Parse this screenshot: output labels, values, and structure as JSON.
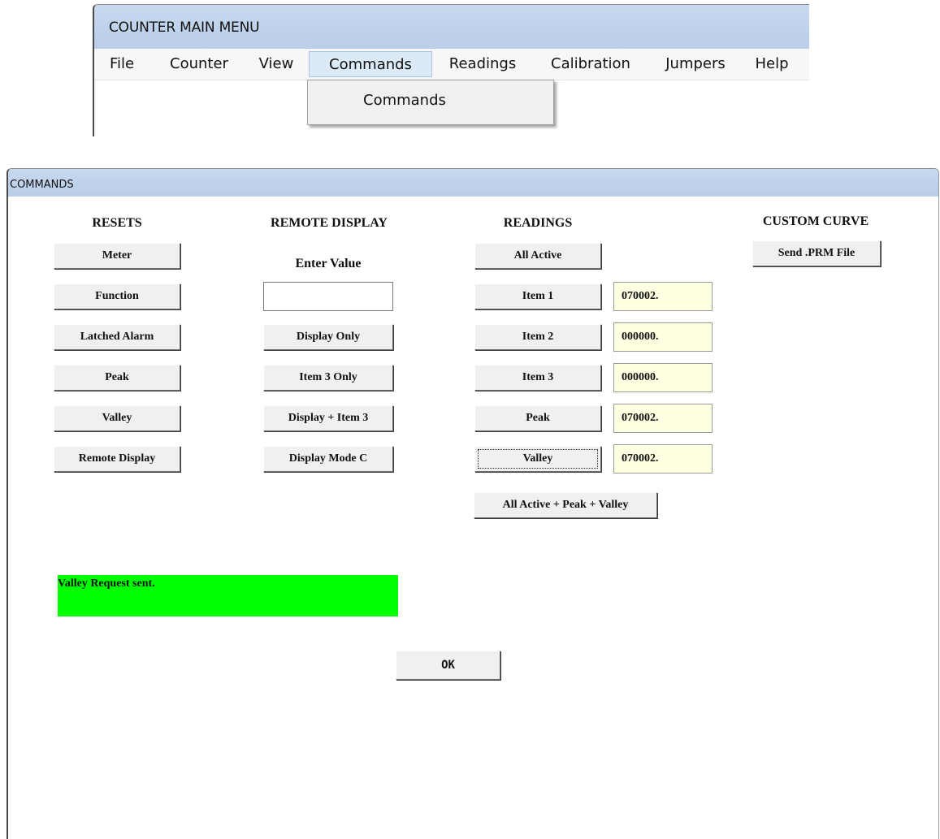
{
  "main_window": {
    "title": "COUNTER MAIN  MENU",
    "menu": [
      "File",
      "Counter",
      "View",
      "Commands",
      "Readings",
      "Calibration",
      "Jumpers",
      "Help"
    ],
    "active_menu": "Commands",
    "dropdown_items": [
      "Commands"
    ]
  },
  "dialog": {
    "title": "COMMANDS",
    "resets": {
      "header": "RESETS",
      "buttons": [
        "Meter",
        "Function",
        "Latched Alarm",
        "Peak",
        "Valley",
        "Remote Display"
      ]
    },
    "remote_display": {
      "header": "REMOTE DISPLAY",
      "enter_value_label": "Enter Value",
      "input_value": "",
      "buttons": [
        "Display Only",
        "Item 3 Only",
        "Display + Item 3",
        "Display Mode C"
      ]
    },
    "readings": {
      "header": "READINGS",
      "all_active_label": "All Active",
      "rows": [
        {
          "label": "Item 1",
          "value": "070002."
        },
        {
          "label": "Item 2",
          "value": "000000."
        },
        {
          "label": "Item 3",
          "value": "000000."
        },
        {
          "label": "Peak",
          "value": "070002."
        },
        {
          "label": "Valley",
          "value": "070002."
        }
      ],
      "combined_label": "All Active + Peak + Valley"
    },
    "custom_curve": {
      "header": "CUSTOM CURVE",
      "button_label": "Send .PRM File"
    },
    "status_message": "Valley Request sent.",
    "ok_label": "OK"
  },
  "colors": {
    "titlebar": "#c7d9ef",
    "status_bg": "#00ff00",
    "value_box_bg": "#ffffe1",
    "menu_active_bg": "#dce9f7"
  }
}
